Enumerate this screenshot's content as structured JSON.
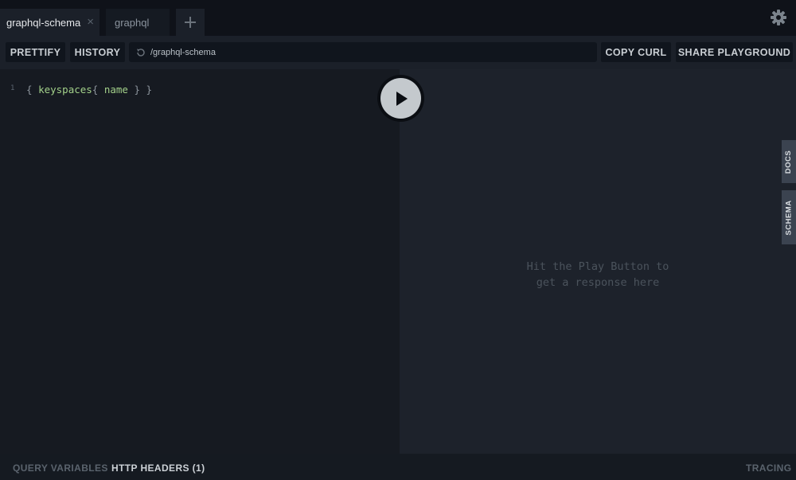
{
  "tabs": [
    {
      "label": "graphql-schema",
      "active": true,
      "close": "×"
    },
    {
      "label": "graphql",
      "active": false
    }
  ],
  "add_tab_icon": "plus-icon",
  "settings_icon": "gear-icon",
  "toolbar": {
    "prettify_label": "PRETTIFY",
    "history_label": "HISTORY",
    "url": "/graphql-schema",
    "reload_icon": "reload-icon",
    "copy_curl_label": "COPY CURL",
    "share_label": "SHARE PLAYGROUND"
  },
  "editor": {
    "line_number": "1",
    "code": {
      "open": "{ ",
      "field1": "keyspaces",
      "brace2": "{ ",
      "field2": "name",
      "close": " } }"
    }
  },
  "play_icon": "play-icon",
  "result": {
    "hint_line1": "Hit the Play Button to",
    "hint_line2": "get a response here"
  },
  "side_tabs": {
    "docs": "DOCS",
    "schema": "SCHEMA"
  },
  "bottom": {
    "query_variables": "QUERY VARIABLES",
    "http_headers": "HTTP HEADERS (1)",
    "tracing": "TRACING"
  },
  "colors": {
    "background": "#0f1219",
    "editor_bg": "#161a21",
    "result_bg": "#1d222b",
    "accent_code": "#a3d18a"
  }
}
